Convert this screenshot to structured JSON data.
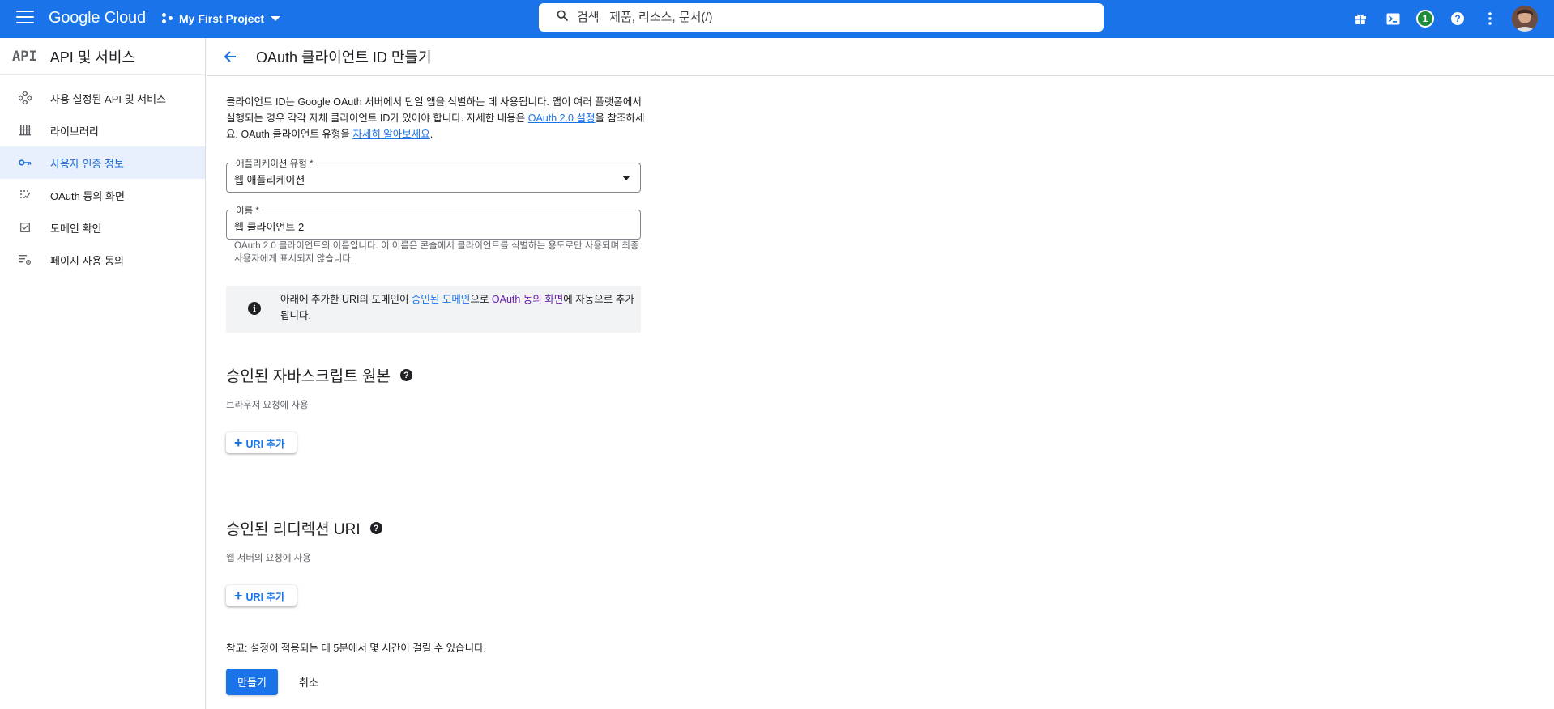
{
  "topbar": {
    "logo_text": "Google Cloud",
    "project_name": "My First Project",
    "search_placeholder": "검색   제품, 리소스, 문서(/)",
    "notification_count": "1",
    "accent_color": "#1a73e8"
  },
  "sidebar": {
    "logo_text": "API",
    "title": "API 및 서비스",
    "items": [
      {
        "label": "사용 설정된 API 및 서비스",
        "icon": "api-diamond-icon",
        "active": false
      },
      {
        "label": "라이브러리",
        "icon": "library-icon",
        "active": false
      },
      {
        "label": "사용자 인증 정보",
        "icon": "key-icon",
        "active": true
      },
      {
        "label": "OAuth 동의 화면",
        "icon": "oauth-consent-icon",
        "active": false
      },
      {
        "label": "도메인 확인",
        "icon": "domain-check-icon",
        "active": false
      },
      {
        "label": "페이지 사용 동의",
        "icon": "page-usage-icon",
        "active": false
      }
    ]
  },
  "page": {
    "title": "OAuth 클라이언트 ID 만들기"
  },
  "form": {
    "desc_part1": "클라이언트 ID는 Google OAuth 서버에서 단일 앱을 식별하는 데 사용됩니다. 앱이 여러 플랫폼에서 실행되는 경우 각각 자체 클라이언트 ID가 있어야 합니다. 자세한 내용은 ",
    "desc_link1": "OAuth 2.0 설정",
    "desc_part2": "을 참조하세요. OAuth 클라이언트 유형을 ",
    "desc_link2": "자세히 알아보세요",
    "desc_part3": ".",
    "app_type_label": "애플리케이션 유형 *",
    "app_type_value": "웹 애플리케이션",
    "name_label": "이름 *",
    "name_value": "웹 클라이언트 2",
    "name_hint": "OAuth 2.0 클라이언트의 이름입니다. 이 이름은 콘솔에서 클라이언트를 식별하는 용도로만 사용되며 최종 사용자에게 표시되지 않습니다.",
    "info_part1": "아래에 추가한 URI의 도메인이 ",
    "info_link1": "승인된 도메인",
    "info_part2": "으로 ",
    "info_link2": "OAuth 동의 화면",
    "info_part3": "에 자동으로 추가됩니다.",
    "js_origins_title": "승인된 자바스크립트 원본",
    "js_origins_sub": "브라우저 요청에 사용",
    "add_uri_label": "URI 추가",
    "redirect_title": "승인된 리디렉션 URI",
    "redirect_sub": "웹 서버의 요청에 사용",
    "note": "참고: 설정이 적용되는 데 5분에서 몇 시간이 걸릴 수 있습니다.",
    "create_label": "만들기",
    "cancel_label": "취소"
  }
}
